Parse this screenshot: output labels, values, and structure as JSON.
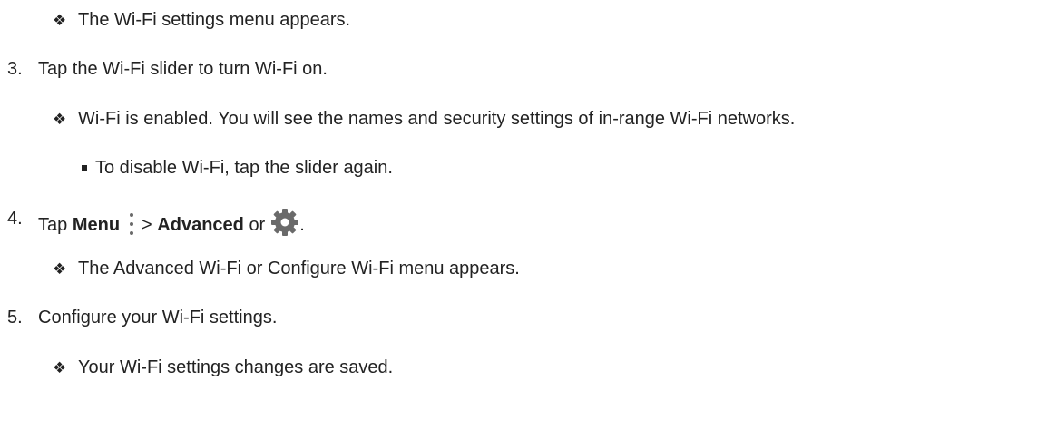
{
  "steps": {
    "s2_result": "The Wi-Fi settings menu appears.",
    "s3_num": "3.",
    "s3_text": "Tap the Wi-Fi slider to turn Wi-Fi on.",
    "s3_result": "Wi-Fi is enabled. You will see the names and security settings of in-range Wi-Fi networks.",
    "s3_note": "To disable Wi-Fi, tap the slider again.",
    "s4_num": "4.",
    "s4_tap": "Tap",
    "s4_menu": "Menu",
    "s4_gt": ">",
    "s4_advanced": "Advanced",
    "s4_or": "or",
    "s4_period": ".",
    "s4_result": "The Advanced Wi-Fi or Configure Wi-Fi menu appears.",
    "s5_num": "5.",
    "s5_text": "Configure your Wi-Fi settings.",
    "s5_result": "Your Wi-Fi settings changes are saved."
  },
  "bullets": {
    "diamond": "❖"
  },
  "icons": {
    "menu": "menu-dots-icon",
    "settings": "gear-icon",
    "gear_color": "#6a6a6a"
  }
}
